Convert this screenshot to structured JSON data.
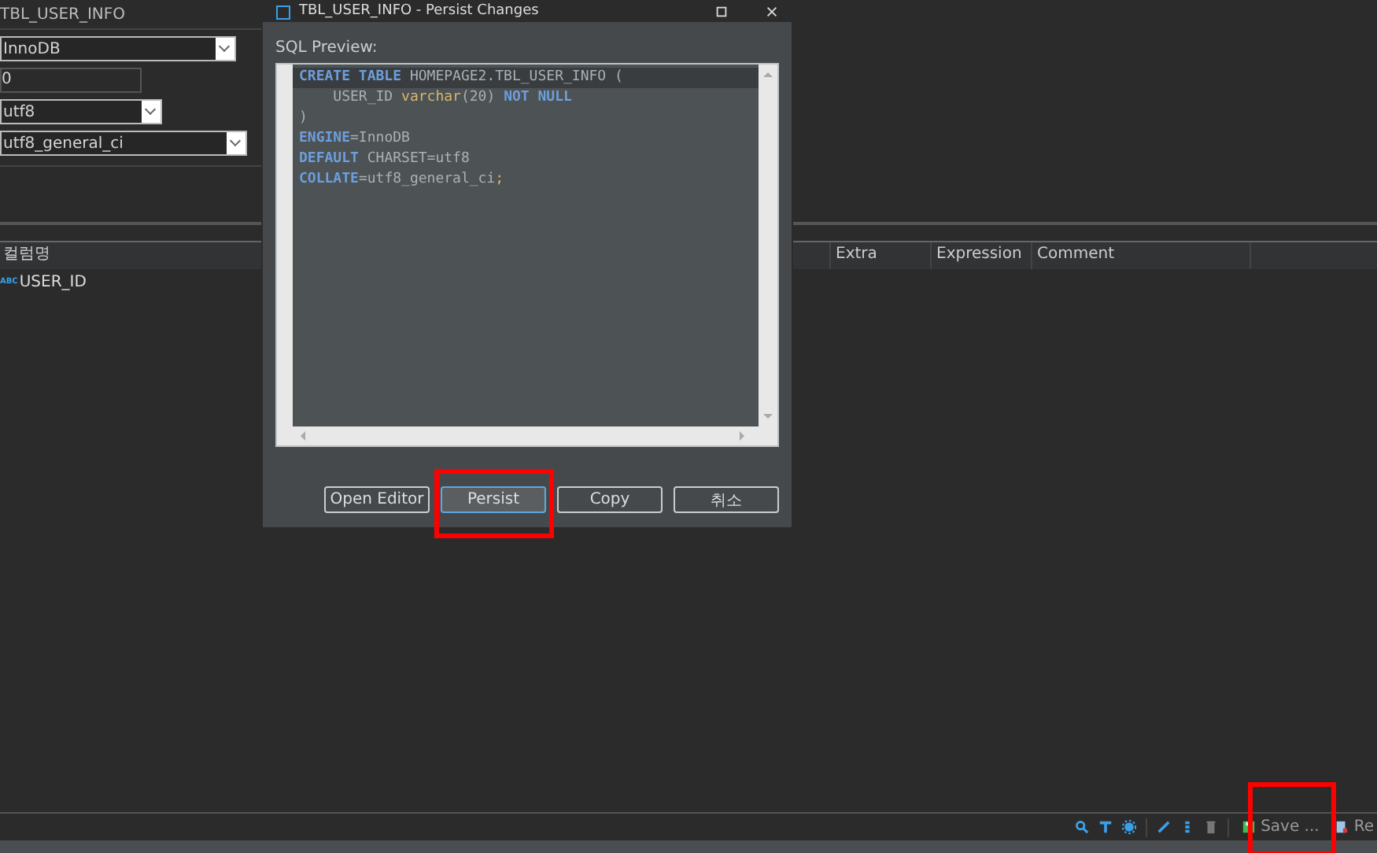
{
  "properties": {
    "table_name": "TBL_USER_INFO",
    "engine": "InnoDB",
    "auto_increment": "0",
    "charset": "utf8",
    "collation": "utf8_general_ci"
  },
  "columns_table": {
    "columns": [
      "컬럼명",
      "Extra",
      "Expression",
      "Comment"
    ],
    "rows": [
      {
        "name": "USER_ID",
        "type_badge": "ABC"
      }
    ]
  },
  "dialog": {
    "title": "TBL_USER_INFO - Persist Changes",
    "preview_label": "SQL Preview:",
    "sql_lines": [
      [
        {
          "kind": "keyword",
          "text": "CREATE TABLE"
        },
        {
          "kind": "plain",
          "text": " HOMEPAGE2.TBL_USER_INFO ("
        }
      ],
      [
        {
          "kind": "plain",
          "text": "    USER_ID "
        },
        {
          "kind": "type",
          "text": "varchar"
        },
        {
          "kind": "plain",
          "text": "(20) "
        },
        {
          "kind": "keyword",
          "text": "NOT NULL"
        }
      ],
      [
        {
          "kind": "plain",
          "text": ")"
        }
      ],
      [
        {
          "kind": "keyword",
          "text": "ENGINE"
        },
        {
          "kind": "plain",
          "text": "=InnoDB"
        }
      ],
      [
        {
          "kind": "keyword",
          "text": "DEFAULT"
        },
        {
          "kind": "plain",
          "text": " CHARSET=utf8"
        }
      ],
      [
        {
          "kind": "keyword",
          "text": "COLLATE"
        },
        {
          "kind": "plain",
          "text": "=utf8_general_ci"
        },
        {
          "kind": "type",
          "text": ";"
        }
      ]
    ],
    "buttons": [
      {
        "label": "Open Editor",
        "selected": false,
        "highlighted": false
      },
      {
        "label": "Persist",
        "selected": true,
        "highlighted": true
      },
      {
        "label": "Copy",
        "selected": false,
        "highlighted": false
      },
      {
        "label": "취소",
        "selected": false,
        "highlighted": false
      }
    ]
  },
  "toolbar": {
    "save_label": "Save ...",
    "save_highlighted": true,
    "revert_label": "Re"
  }
}
